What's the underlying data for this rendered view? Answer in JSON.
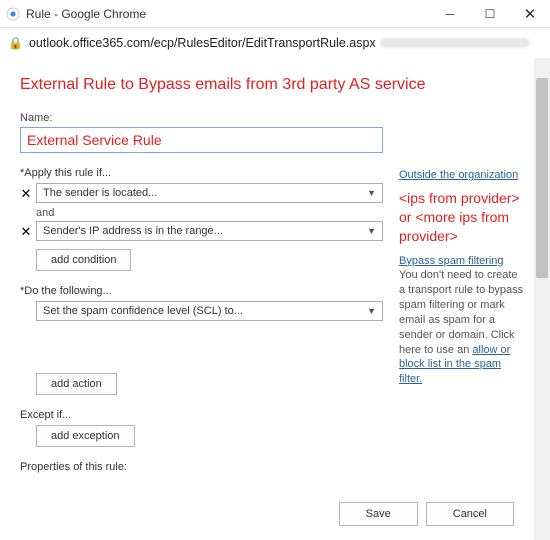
{
  "window": {
    "title": "Rule - Google Chrome",
    "url": "outlook.office365.com/ecp/RulesEditor/EditTransportRule.aspx"
  },
  "callout_title": "External Rule to Bypass emails from 3rd party AS service",
  "form": {
    "name_label": "Name:",
    "name_value": "External Service Rule",
    "apply_label": "*Apply this rule if...",
    "cond1": "The sender is located...",
    "and": "and",
    "cond2": "Sender's IP address is in the range...",
    "add_condition": "add condition",
    "do_label": "*Do the following...",
    "action1": "Set the spam confidence level (SCL) to...",
    "add_action": "add action",
    "except_label": "Except if...",
    "add_exception": "add exception",
    "properties_label": "Properties of this rule:"
  },
  "side": {
    "outside_org": "Outside the organization",
    "red_note": "<ips from provider> or <more ips from provider>",
    "bypass_heading": "Bypass spam filtering",
    "bypass_text": "You don't need to create a transport rule to bypass spam filtering or mark email as spam for a sender or domain. Click here to use an ",
    "bypass_link": "allow or block list in the spam filter."
  },
  "footer": {
    "save": "Save",
    "cancel": "Cancel"
  }
}
